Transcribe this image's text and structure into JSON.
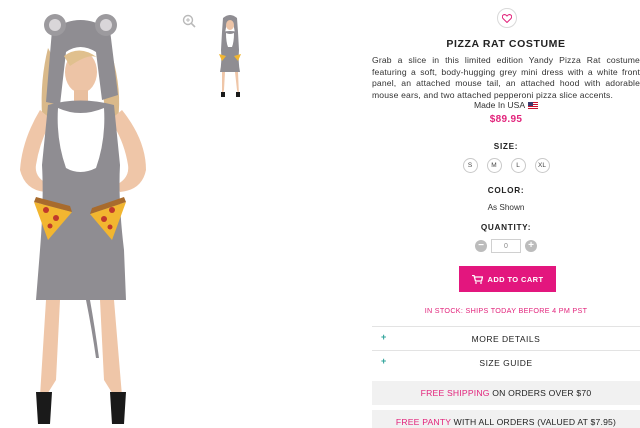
{
  "product": {
    "title": "PIZZA RAT COSTUME",
    "description": "Grab a slice in this limited edition Yandy Pizza Rat costume featuring a soft, body-hugging grey mini dress with a white front panel, an attached mouse tail, an attached hood with adorable mouse ears, and two attached pepperoni pizza slice accents.",
    "made_in": "Made In USA",
    "price": "$89.95"
  },
  "options": {
    "size_label": "SIZE:",
    "sizes": [
      "S",
      "M",
      "L",
      "XL"
    ],
    "color_label": "COLOR:",
    "color_value": "As Shown",
    "quantity_label": "QUANTITY:",
    "quantity_value": "0",
    "minus": "−",
    "plus": "+"
  },
  "cart": {
    "label": "ADD TO CART"
  },
  "stock": {
    "text": "IN STOCK: SHIPS TODAY BEFORE 4 PM PST"
  },
  "accordion": [
    {
      "plus": "+",
      "label": "MORE DETAILS"
    },
    {
      "plus": "+",
      "label": "SIZE GUIDE"
    }
  ],
  "promos": [
    {
      "highlight": "FREE SHIPPING",
      "rest": " ON ORDERS OVER $70"
    },
    {
      "highlight": "FREE PANTY",
      "rest": " WITH ALL ORDERS (VALUED AT $7.95)"
    }
  ],
  "colors": {
    "accent": "#e2237b",
    "cart_bg": "#e3167e",
    "costume_grey": "#8f8d92"
  },
  "icons": {
    "zoom": "zoom-icon",
    "wishlist": "heart-icon",
    "cart": "cart-icon",
    "flag": "usa-flag-icon"
  }
}
